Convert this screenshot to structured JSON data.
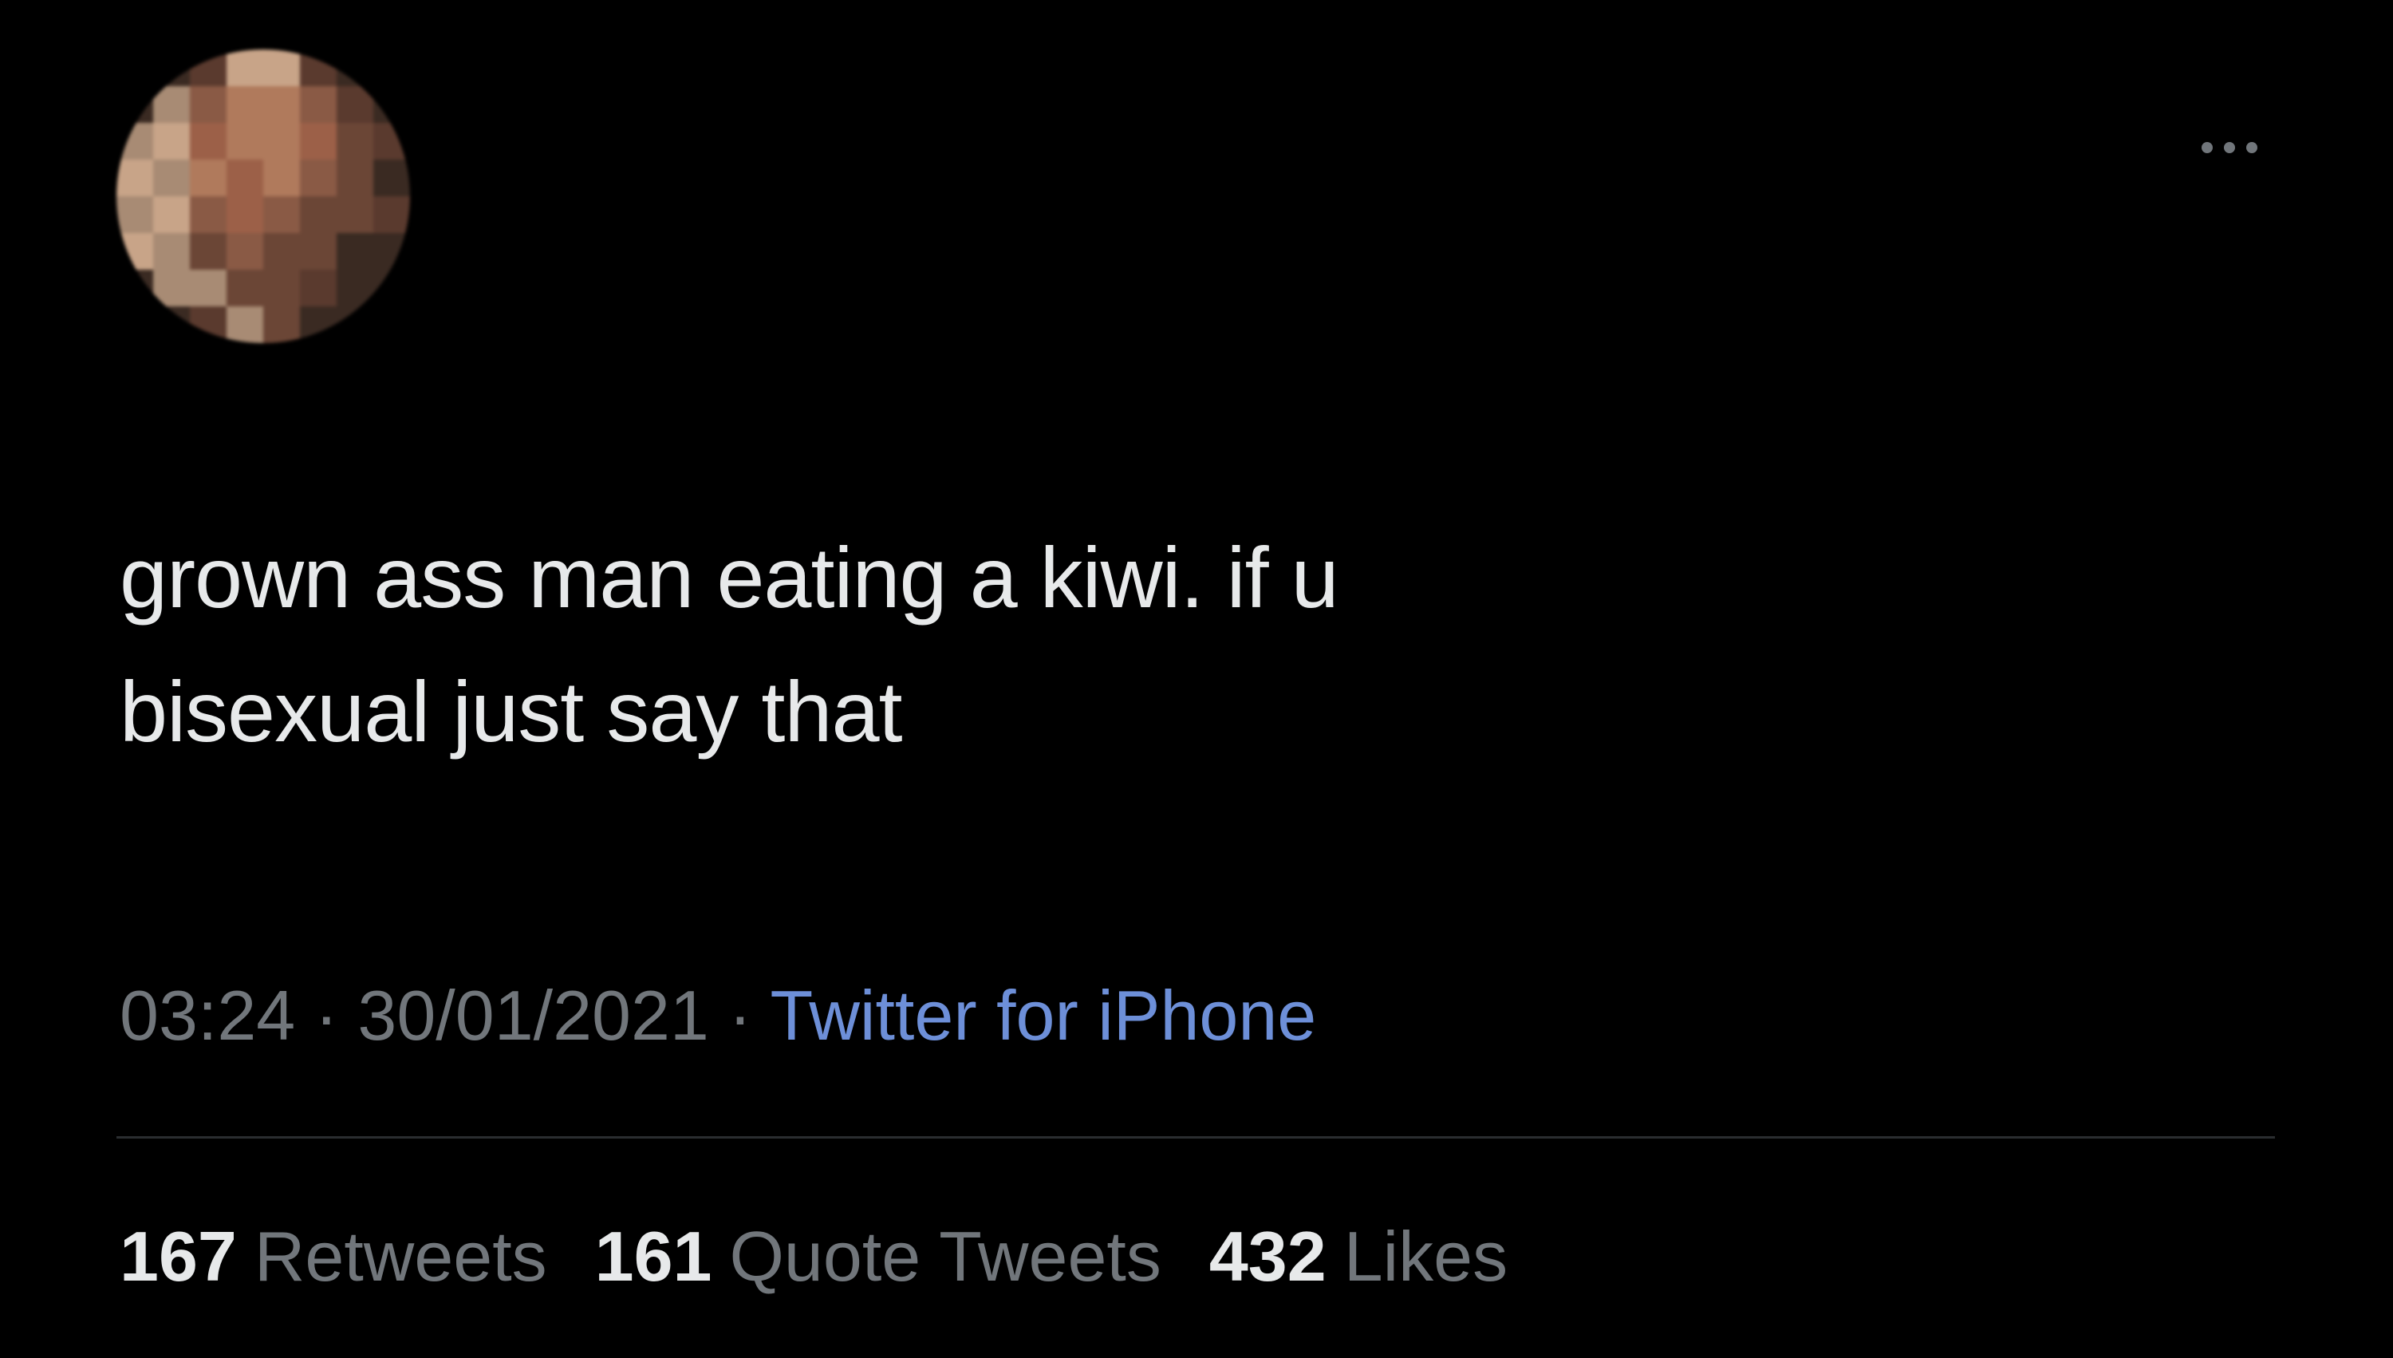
{
  "tweet": {
    "avatar": {
      "description_colors": [
        "#3a2a22",
        "#8a5a45",
        "#b07a5c",
        "#9c6048",
        "#6b4636",
        "#c8a488",
        "#a88b74",
        "#5a3a2e"
      ]
    },
    "more_icon": "more-dots-icon",
    "text": "grown ass man eating a kiwi. if u\nbisexual just say that",
    "meta": {
      "time": "03:24",
      "separator": " · ",
      "date": "30/01/2021",
      "source": "Twitter for iPhone"
    },
    "stats": {
      "retweets_count": "167",
      "retweets_label": "Retweets",
      "quote_tweets_count": "161",
      "quote_tweets_label": "Quote Tweets",
      "likes_count": "432",
      "likes_label": "Likes"
    },
    "colors": {
      "background": "#000000",
      "text": "#e7e9ea",
      "secondary": "#71767b",
      "link": "#6d8fd8"
    }
  }
}
